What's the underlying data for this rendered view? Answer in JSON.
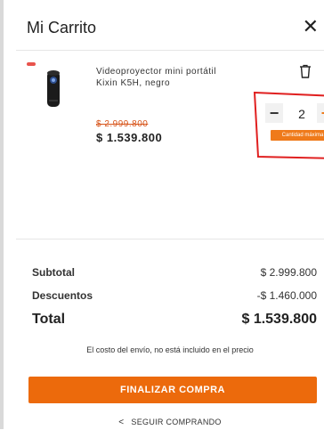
{
  "cart": {
    "title": "Mi Carrito",
    "item": {
      "name": "Videoproyector mini portátil Kixin K5H, negro",
      "old_price": "$ 2.999.800",
      "price": "$ 1.539.800",
      "quantity": "2",
      "max_label": "Cantidad máxima"
    },
    "summary": {
      "subtotal_label": "Subtotal",
      "subtotal_value": "$ 2.999.800",
      "discount_label": "Descuentos",
      "discount_value": "-$ 1.460.000",
      "total_label": "Total",
      "total_value": "$ 1.539.800",
      "shipping_note": "El costo del envío, no está incluido en el precio"
    },
    "actions": {
      "checkout_label": "FINALIZAR COMPRA",
      "continue_label": "SEGUIR COMPRANDO"
    }
  },
  "icons": {
    "close": "close-icon",
    "trash": "trash-icon",
    "back": "chevron-left-icon"
  },
  "colors": {
    "accent": "#ec6a0c",
    "strike_price": "#d7541a",
    "annotation": "#e02020"
  }
}
